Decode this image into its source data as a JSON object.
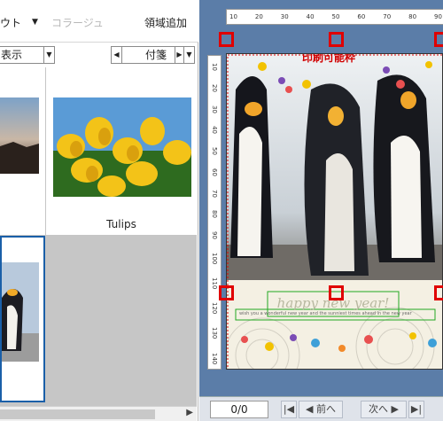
{
  "toolbar": {
    "layout_label": "ウト",
    "collage_label": "コラージュ",
    "add_area_label": "領域追加"
  },
  "filters": {
    "display_value": "表示",
    "tag_value": "付箋"
  },
  "thumbnails": [
    {
      "caption": ""
    },
    {
      "caption": "Tulips"
    },
    {
      "caption": ""
    }
  ],
  "canvas": {
    "title_text": "印刷可能枠",
    "greeting_text": "happy new year!",
    "message_text": "wish you a wonderful new year and the sunniest times ahead in the new year",
    "top_ruler_marks": [
      "10",
      "20",
      "30",
      "40",
      "50",
      "60",
      "70",
      "80",
      "90"
    ],
    "left_ruler_marks": [
      "10",
      "20",
      "30",
      "40",
      "50",
      "60",
      "70",
      "80",
      "90",
      "100",
      "110",
      "120",
      "130",
      "140"
    ]
  },
  "pager": {
    "page_value": "0/0",
    "prev_label": "前へ",
    "next_label": "次へ"
  }
}
